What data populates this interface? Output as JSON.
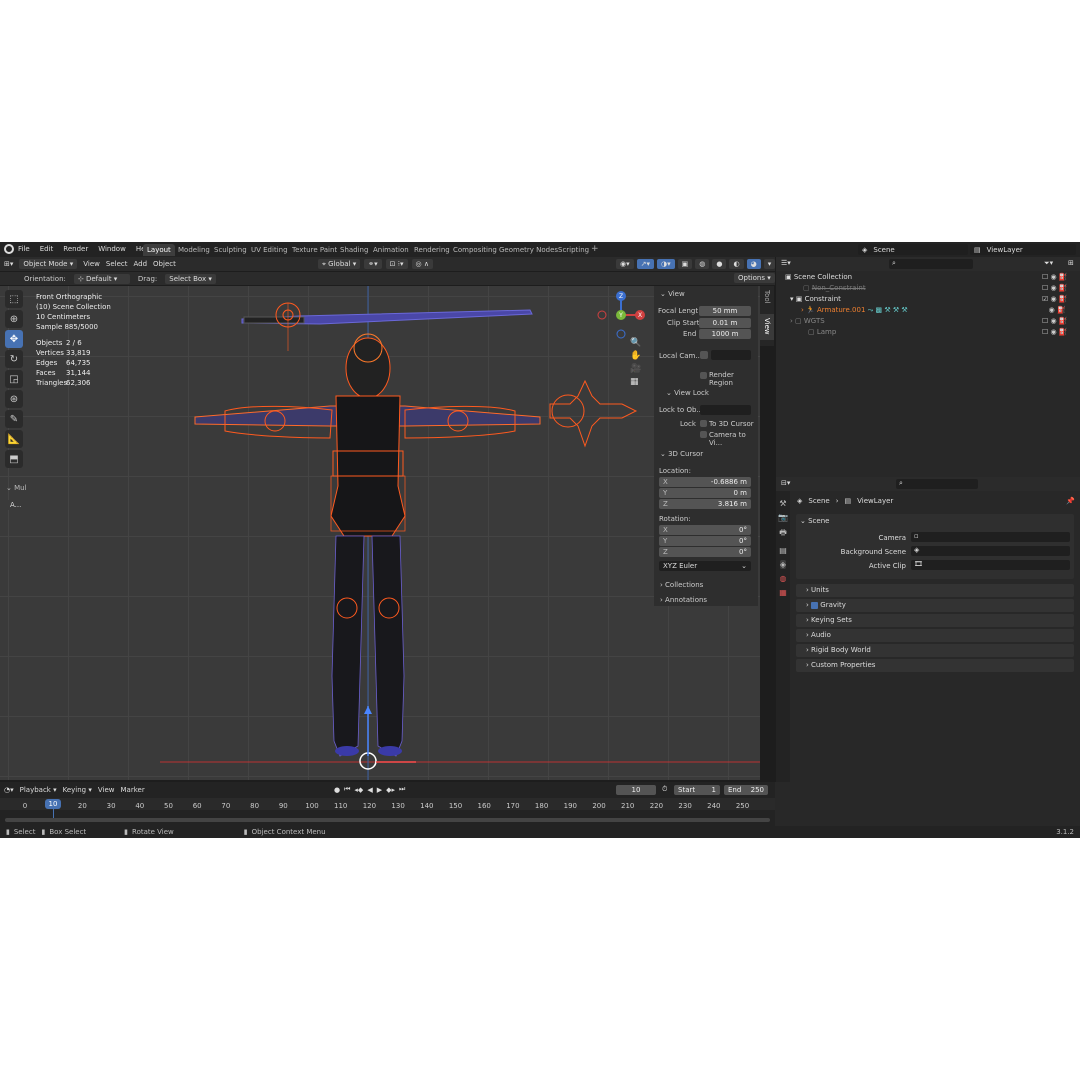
{
  "menu": [
    "File",
    "Edit",
    "Render",
    "Window",
    "Help"
  ],
  "workspaces": [
    "Layout",
    "Modeling",
    "Sculpting",
    "UV Editing",
    "Texture Paint",
    "Shading",
    "Animation",
    "Rendering",
    "Compositing",
    "Geometry Nodes",
    "Scripting"
  ],
  "scene_name": "Scene",
  "view_layer": "ViewLayer",
  "header": {
    "mode": "Object Mode",
    "view": "View",
    "select": "Select",
    "add": "Add",
    "object": "Object",
    "transform": "Global"
  },
  "toolsettings": {
    "orientation_label": "Orientation:",
    "orientation": "Default",
    "drag_label": "Drag:",
    "drag": "Select Box",
    "options": "Options"
  },
  "overlay": {
    "view_name": "Front Orthographic",
    "collection": "(10) Scene Collection",
    "scale": "10 Centimeters",
    "sample": "Sample 885/5000",
    "stats": [
      {
        "k": "Objects",
        "v": "2 / 6"
      },
      {
        "k": "Vertices",
        "v": "33,819"
      },
      {
        "k": "Edges",
        "v": "64,735"
      },
      {
        "k": "Faces",
        "v": "31,144"
      },
      {
        "k": "Triangles",
        "v": "62,306"
      }
    ]
  },
  "tool_panel": {
    "label": "Mul",
    "btn": "A..."
  },
  "npanel": {
    "tabs": [
      "Tool",
      "View"
    ],
    "view": "View",
    "focal_label": "Focal Lengt",
    "focal": "50 mm",
    "clip_start_label": "Clip Start",
    "clip_start": "0.01 m",
    "end_label": "End",
    "end": "1000 m",
    "local_cam": "Local Cam...",
    "render_region": "Render Region",
    "view_lock": "View Lock",
    "lock_obj": "Lock to Ob...",
    "lock": "Lock",
    "to_cursor": "To 3D Cursor",
    "camera_to_view": "Camera to Vi...",
    "cursor": "3D Cursor",
    "location": "Location:",
    "x": "-0.6886 m",
    "y": "0 m",
    "z": "3.816 m",
    "rotation": "Rotation:",
    "rx": "0°",
    "ry": "0°",
    "rz": "0°",
    "euler": "XYZ Euler",
    "collections": "Collections",
    "annotations": "Annotations",
    "axis_x": "X",
    "axis_y": "Y",
    "axis_z": "Z"
  },
  "outliner": {
    "root": "Scene Collection",
    "items": [
      {
        "label": "Non_Constraint"
      },
      {
        "label": "Constraint"
      },
      {
        "label": "Armature.001"
      },
      {
        "label": "WGTS"
      },
      {
        "label": "Lamp"
      }
    ]
  },
  "properties": {
    "breadcrumb_scene": "Scene",
    "breadcrumb_layer": "ViewLayer",
    "section": "Scene",
    "camera": "Camera",
    "background": "Background Scene",
    "active_clip": "Active Clip",
    "panels": [
      "Units",
      "Gravity",
      "Keying Sets",
      "Audio",
      "Rigid Body World",
      "Custom Properties"
    ]
  },
  "timeline": {
    "menus": [
      "Playback",
      "Keying",
      "View",
      "Marker"
    ],
    "current_frame": "10",
    "start_label": "Start",
    "start": "1",
    "end_label": "End",
    "end": "250",
    "ticks": [
      "0",
      "10",
      "20",
      "30",
      "40",
      "50",
      "60",
      "70",
      "80",
      "90",
      "100",
      "110",
      "120",
      "130",
      "140",
      "150",
      "160",
      "170",
      "180",
      "190",
      "200",
      "210",
      "220",
      "230",
      "240",
      "250"
    ]
  },
  "status": {
    "select": "Select",
    "box_select": "Box Select",
    "rotate": "Rotate View",
    "context": "Object Context Menu",
    "version": "3.1.2"
  },
  "colors": {
    "accent": "#4772b3",
    "bone": "#ff5a1f",
    "select_orange": "#f08030"
  }
}
